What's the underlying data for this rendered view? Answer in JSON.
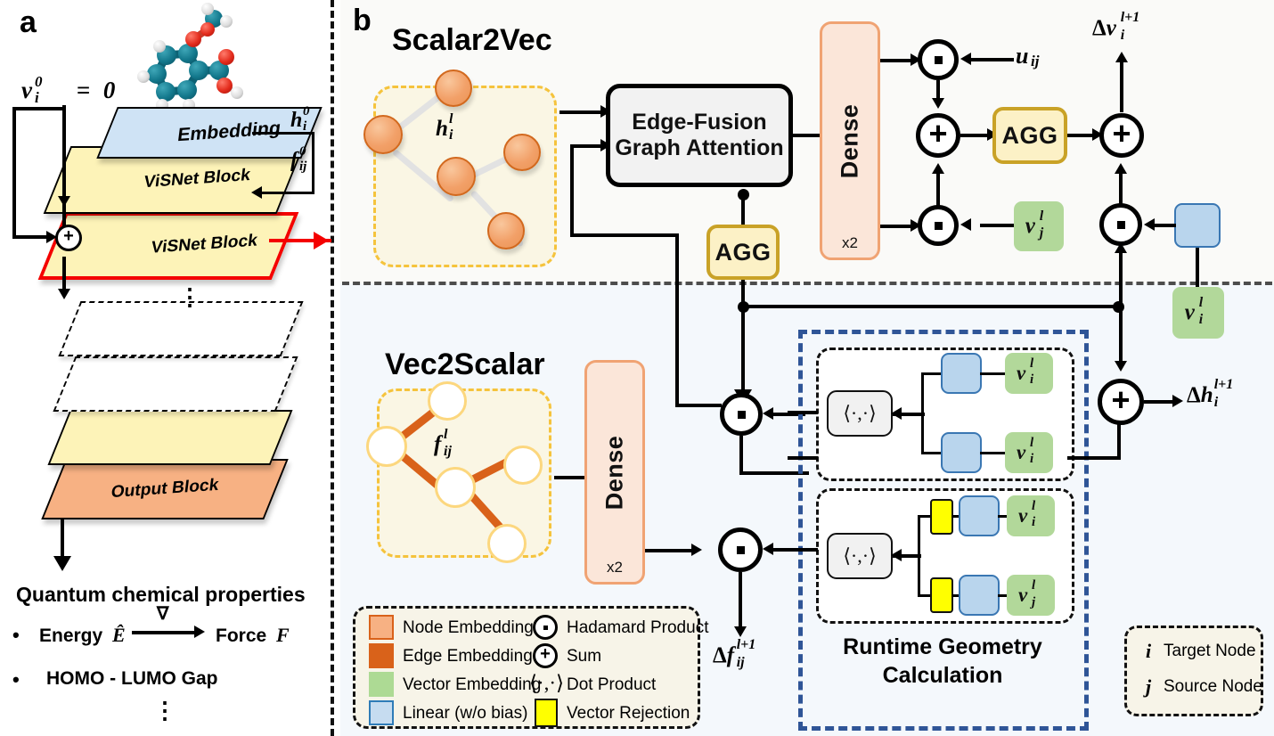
{
  "panels": {
    "a_label": "a",
    "b_label": "b"
  },
  "panel_a": {
    "v_init_label": "v⃗i0 = 0⃗",
    "embedding_label": "Embedding",
    "visnet_block_1": "ViSNet Block",
    "visnet_block_2": "ViSNet Block",
    "output_block": "Output Block",
    "h0_label": "h0i",
    "f0_label": "f0ij",
    "vdots": "⋮",
    "vdots2": "⋮",
    "properties_title": "Quantum chemical properties",
    "prop_bullet1_a": "Energy",
    "prop_bullet1_e": "Ê",
    "prop_bullet1_grad": "∇",
    "prop_bullet1_b": "Force",
    "prop_bullet1_f": "F⃗",
    "prop_bullet2": "HOMO - LUMO Gap",
    "bullet_glyph": "•",
    "molecule_name": "aspirin-molecule"
  },
  "panel_b": {
    "scalar2vec_title": "Scalar2Vec",
    "vec2scalar_title": "Vec2Scalar",
    "h_node_label": "hli",
    "f_edge_label": "flij",
    "efga_line1": "Edge-Fusion",
    "efga_line2": "Graph Attention",
    "dense_label": "Dense",
    "dense_repeat": "x2",
    "agg_label": "AGG",
    "dot_product_symbol": "⟨·,·⟩",
    "u_ij_label": "u⃗ij",
    "v_j_label": "v⃗lj",
    "v_i_label": "v⃗li",
    "out_delta_v": "Δv⃗l+1i",
    "out_delta_h": "Δhl+1i",
    "out_delta_f": "Δfl+1ij",
    "runtime_geometry_line1": "Runtime Geometry",
    "runtime_geometry_line2": "Calculation",
    "sum_symbol": "+",
    "hadamard_symbol": "·"
  },
  "legend": {
    "items": [
      {
        "swatch": "node",
        "label": "Node Embedding"
      },
      {
        "swatch": "edge",
        "label": "Edge Embedding"
      },
      {
        "swatch": "vec",
        "label": "Vector Embedding"
      },
      {
        "swatch": "lin",
        "label": "Linear (w/o bias)"
      }
    ],
    "ops": [
      {
        "symbol": "·",
        "label": "Hadamard Product"
      },
      {
        "symbol": "+",
        "label": "Sum"
      },
      {
        "symbol": "⟨·,·⟩",
        "label": "Dot Product"
      },
      {
        "symbol": "rect",
        "label": "Vector Rejection"
      }
    ]
  },
  "node_legend": {
    "target_symbol": "i",
    "target_label": "Target Node",
    "source_symbol": "j",
    "source_label": "Source Node"
  },
  "colors": {
    "node_embedding": "#f7b183",
    "edge_embedding": "#d9621a",
    "vector_embedding": "#adda94",
    "linear": "#c6dcf0",
    "vector_rejection": "#ffff00",
    "agg_fill": "#fcf1c6",
    "agg_border": "#c9a227",
    "dense_fill": "#fbe6d9",
    "dense_border": "#f0a373",
    "embedding_slab": "#cfe3f5",
    "visnet_slab": "#fdf3b8",
    "output_slab": "#f7b183",
    "highlight_red": "#f40000",
    "runtime_frame": "#2f5597",
    "panel_b_top_bg": "#fafaf8",
    "panel_b_bottom_bg": "#f4f8fc"
  }
}
